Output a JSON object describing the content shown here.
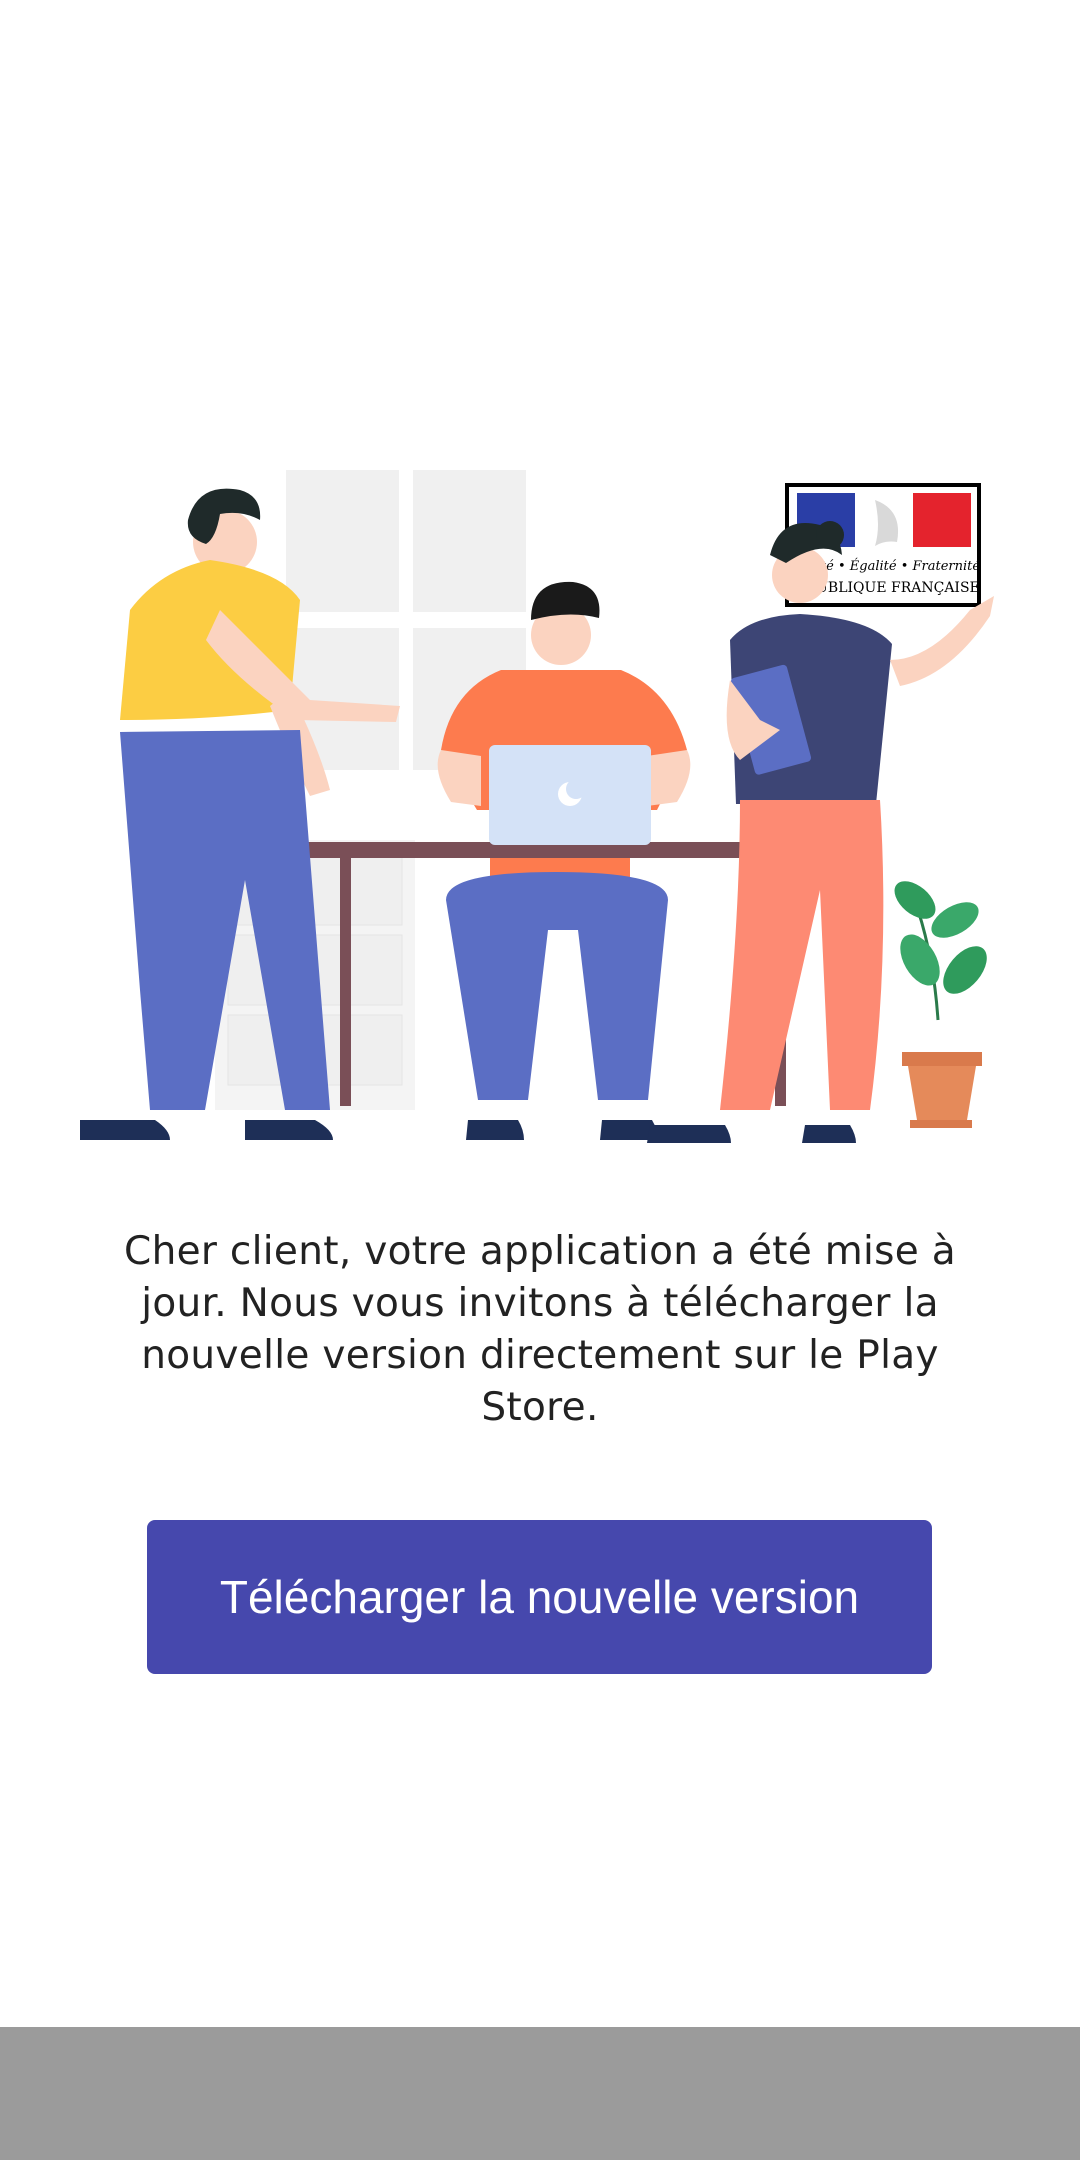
{
  "app": {
    "illustration_name": "team-working-illustration",
    "logo": {
      "motto": "Liberté • Égalité • Fraternité",
      "country": "RÉPUBLIQUE FRANÇAISE"
    }
  },
  "main": {
    "message": "Cher client, votre application a été mise à jour. Nous vous invitons à télécharger la nouvelle version directement sur le Play Store.",
    "download_button_label": "Télécharger la nouvelle version"
  },
  "colors": {
    "button": "#4648ad",
    "text": "#222222",
    "nav_bar": "#9b9b9b",
    "background": "#ffffff"
  }
}
